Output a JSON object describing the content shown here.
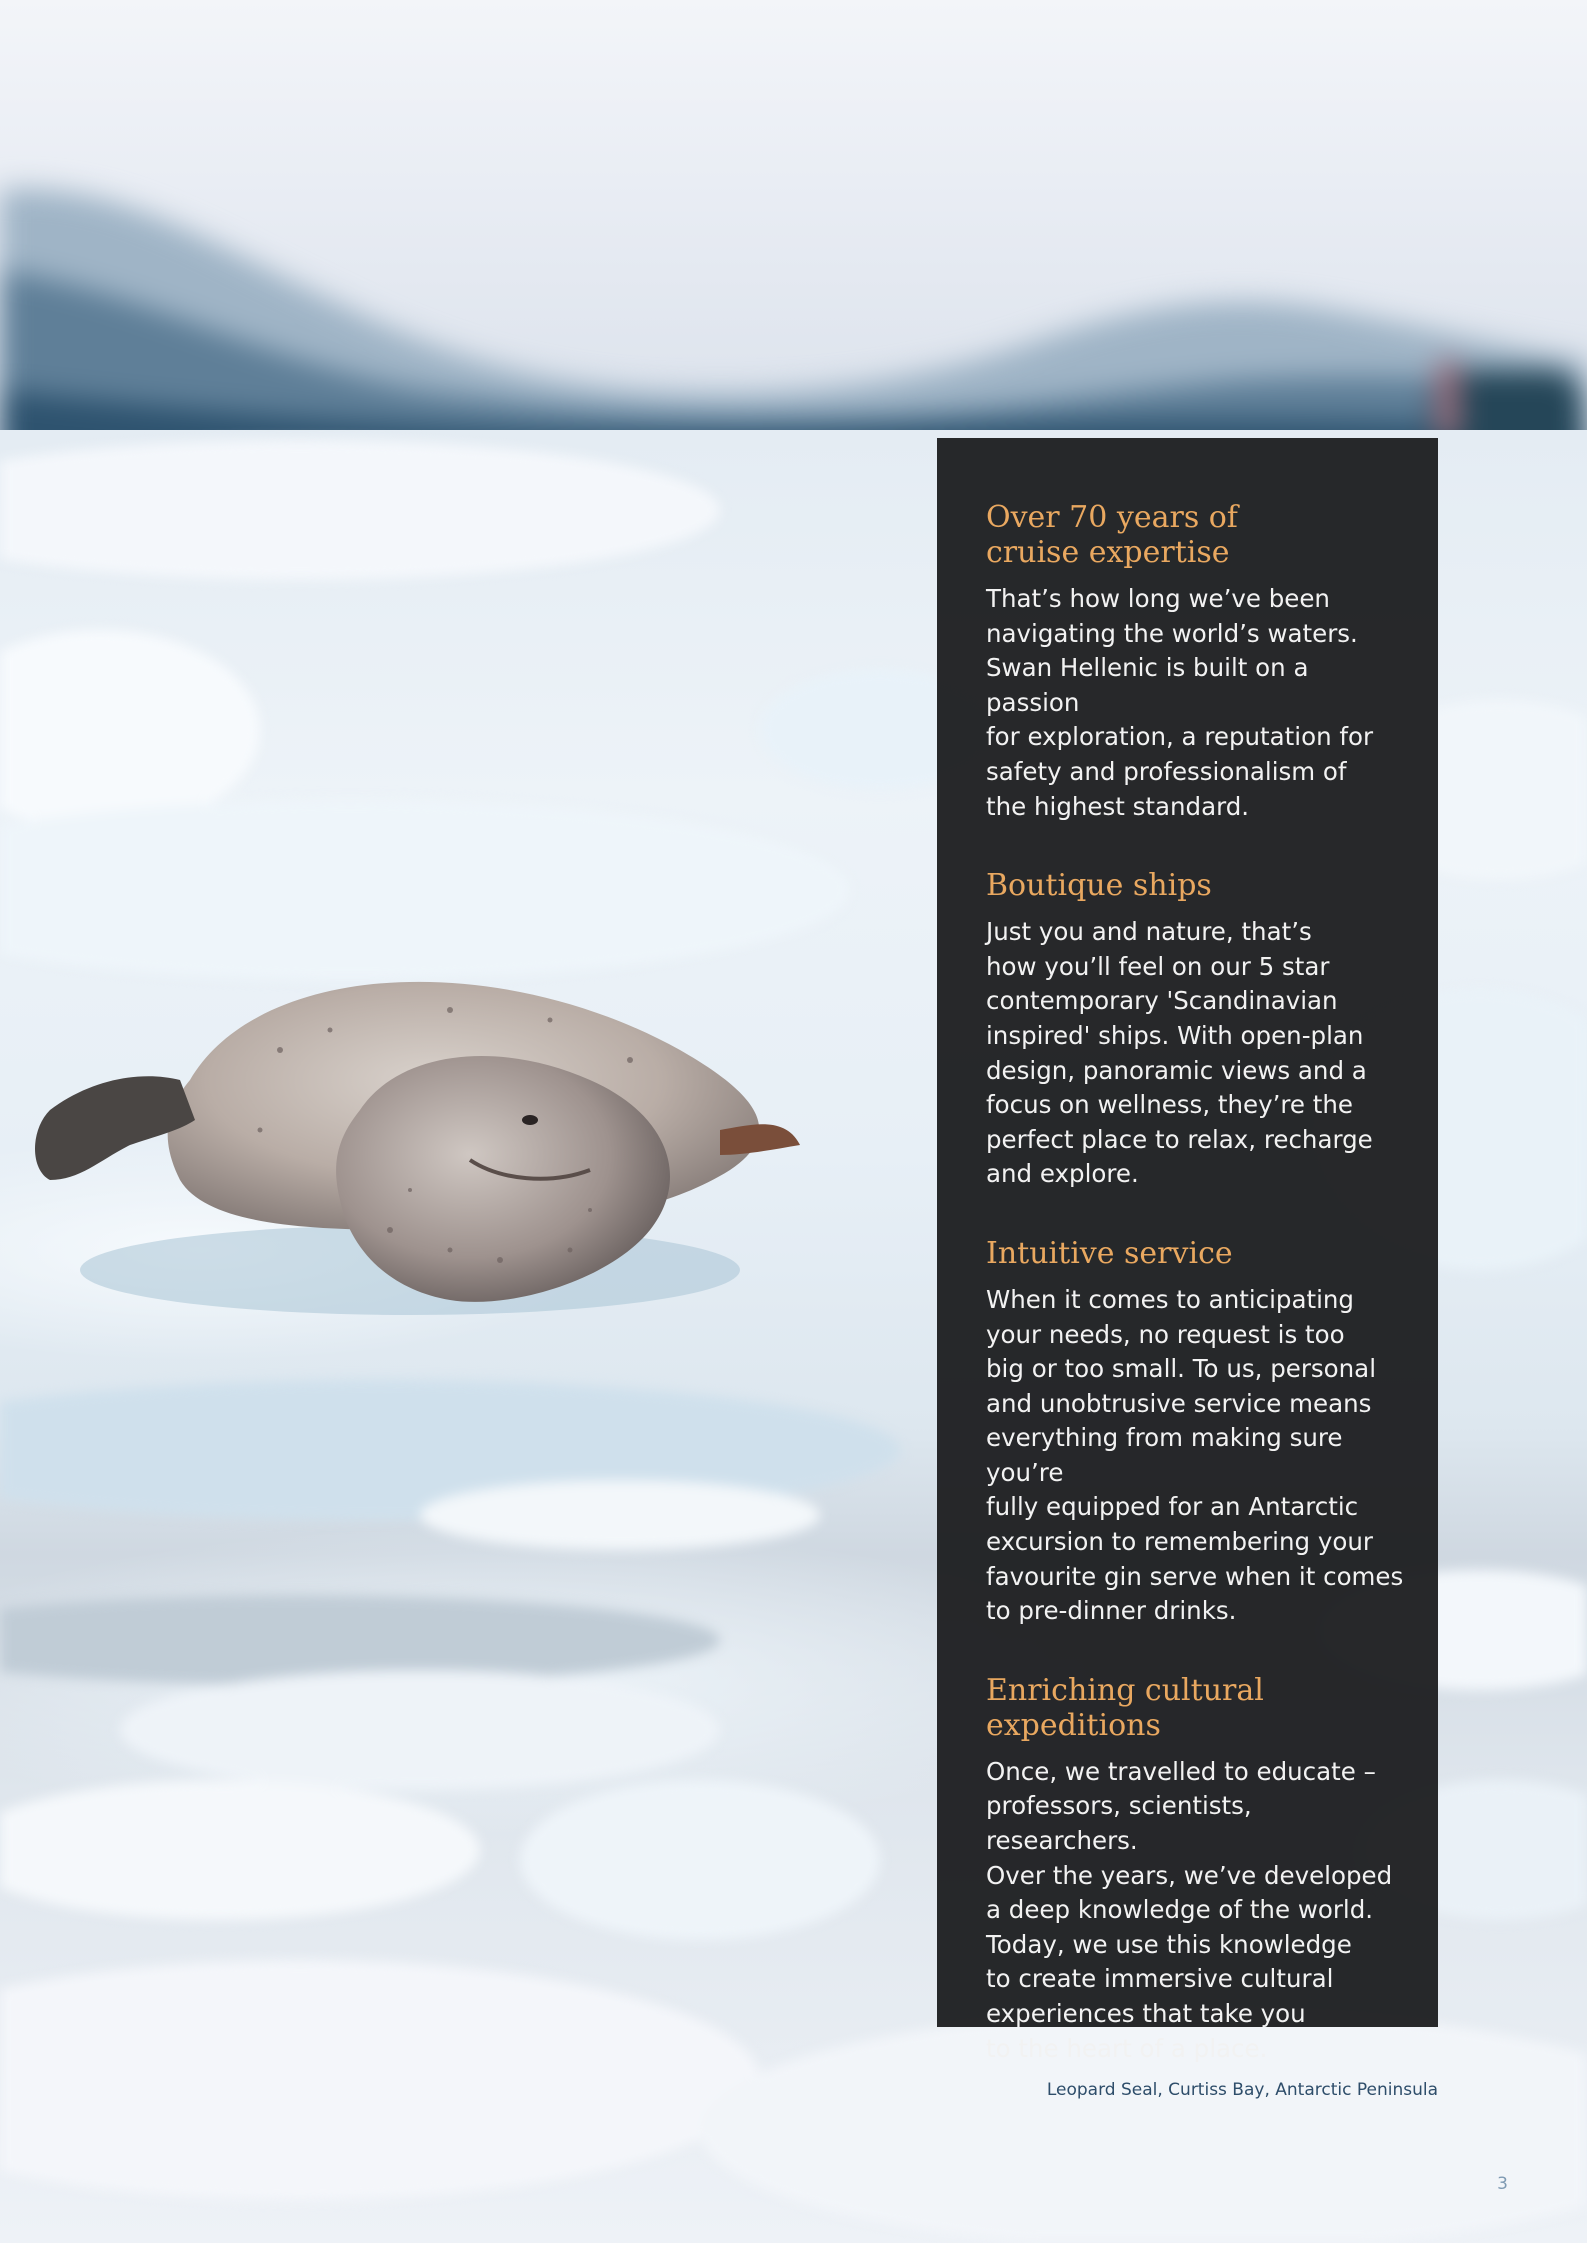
{
  "sections": [
    {
      "heading": "Over 70 years of\ncruise expertise",
      "body": "That’s how long we’ve been\nnavigating the world’s waters.\nSwan Hellenic is built on a passion\nfor exploration, a reputation for\nsafety and professionalism of\nthe highest standard."
    },
    {
      "heading": "Boutique ships",
      "body": "Just you and nature, that’s\nhow you’ll feel on our 5 star\ncontemporary 'Scandinavian\ninspired' ships. With open-plan\ndesign, panoramic views and a\nfocus on wellness, they’re the\nperfect place to relax, recharge\nand explore."
    },
    {
      "heading": "Intuitive service",
      "body": "When it comes to anticipating\nyour needs, no request is too\nbig or too small. To us, personal\nand unobtrusive service means\neverything from making sure you’re\nfully equipped for an Antarctic\nexcursion to remembering your\nfavourite gin serve when it comes\nto pre-dinner drinks."
    },
    {
      "heading": "Enriching cultural\nexpeditions",
      "body": "Once, we travelled to educate –\nprofessors, scientists, researchers.\nOver the years, we’ve developed\na deep knowledge of the world.\nToday, we use this knowledge\nto create immersive cultural\nexperiences that take you\nto the heart of a place."
    }
  ],
  "photo_caption": "Leopard Seal, Curtiss Bay, Antarctic Peninsula",
  "page_number": "3",
  "colors": {
    "panel_background": "#1e1f21",
    "heading": "#e9a860",
    "body_text": "#f2f2f2",
    "caption": "#2e4d6a",
    "page_number": "#7f9ab3"
  }
}
